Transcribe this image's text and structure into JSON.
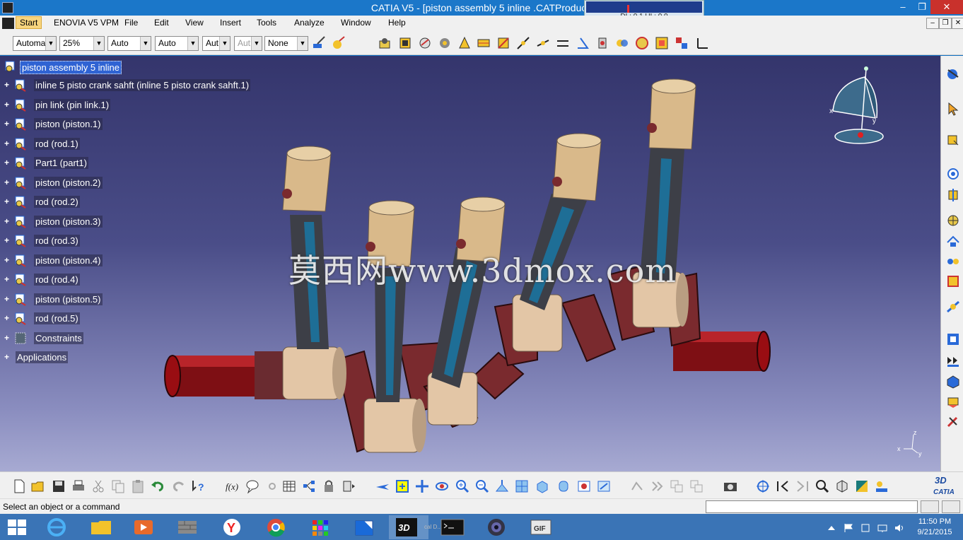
{
  "window": {
    "title": "CATIA V5 - [piston assembly 5 inline .CATProduct]",
    "perf_readout": "DL: 0.1 UL: 0.0"
  },
  "menu": {
    "items": [
      "Start",
      "ENOVIA V5 VPM",
      "File",
      "Edit",
      "View",
      "Insert",
      "Tools",
      "Analyze",
      "Window",
      "Help"
    ]
  },
  "toolbar_top": {
    "combos": [
      {
        "value": "Automa",
        "disabled": false
      },
      {
        "value": "25%",
        "disabled": false
      },
      {
        "value": "Auto",
        "disabled": false
      },
      {
        "value": "Auto",
        "disabled": false
      },
      {
        "value": "Aut",
        "disabled": false
      },
      {
        "value": "Aut",
        "disabled": true
      },
      {
        "value": "None",
        "disabled": false
      }
    ]
  },
  "tree": {
    "root": "piston assembly 5 inline",
    "children": [
      "inline 5 pisto crank sahft (inline 5 pisto crank sahft.1)",
      "pin link (pin link.1)",
      "piston (piston.1)",
      "rod (rod.1)",
      "Part1 (part1)",
      "piston (piston.2)",
      "rod (rod.2)",
      "piston (piston.3)",
      "rod (rod.3)",
      "piston (piston.4)",
      "rod (rod.4)",
      "piston (piston.5)",
      "rod (rod.5)"
    ],
    "constraints": "Constraints",
    "applications": "Applications"
  },
  "viewport": {
    "watermark": "莫西网www.3dmox.com",
    "compass": {
      "x": "x",
      "y": "y"
    },
    "axes": {
      "x": "x",
      "y": "y",
      "z": "z"
    }
  },
  "status": {
    "message": "Select an object or a command"
  },
  "brand": {
    "catia": "CATIA",
    "catia_prefix": "3D"
  },
  "taskbar": {
    "time": "11:50 PM",
    "date": "9/21/2015",
    "gif_label": "GIF",
    "thumb_label": "cal D..."
  },
  "colors": {
    "titlebar": "#1b77c9",
    "selection": "#2f63d3",
    "piston": "#d9b98a",
    "rod": "#3d3f47",
    "crank": "#7a2a2e",
    "shaft": "#a0151a",
    "bearing": "#e3c6a6"
  }
}
